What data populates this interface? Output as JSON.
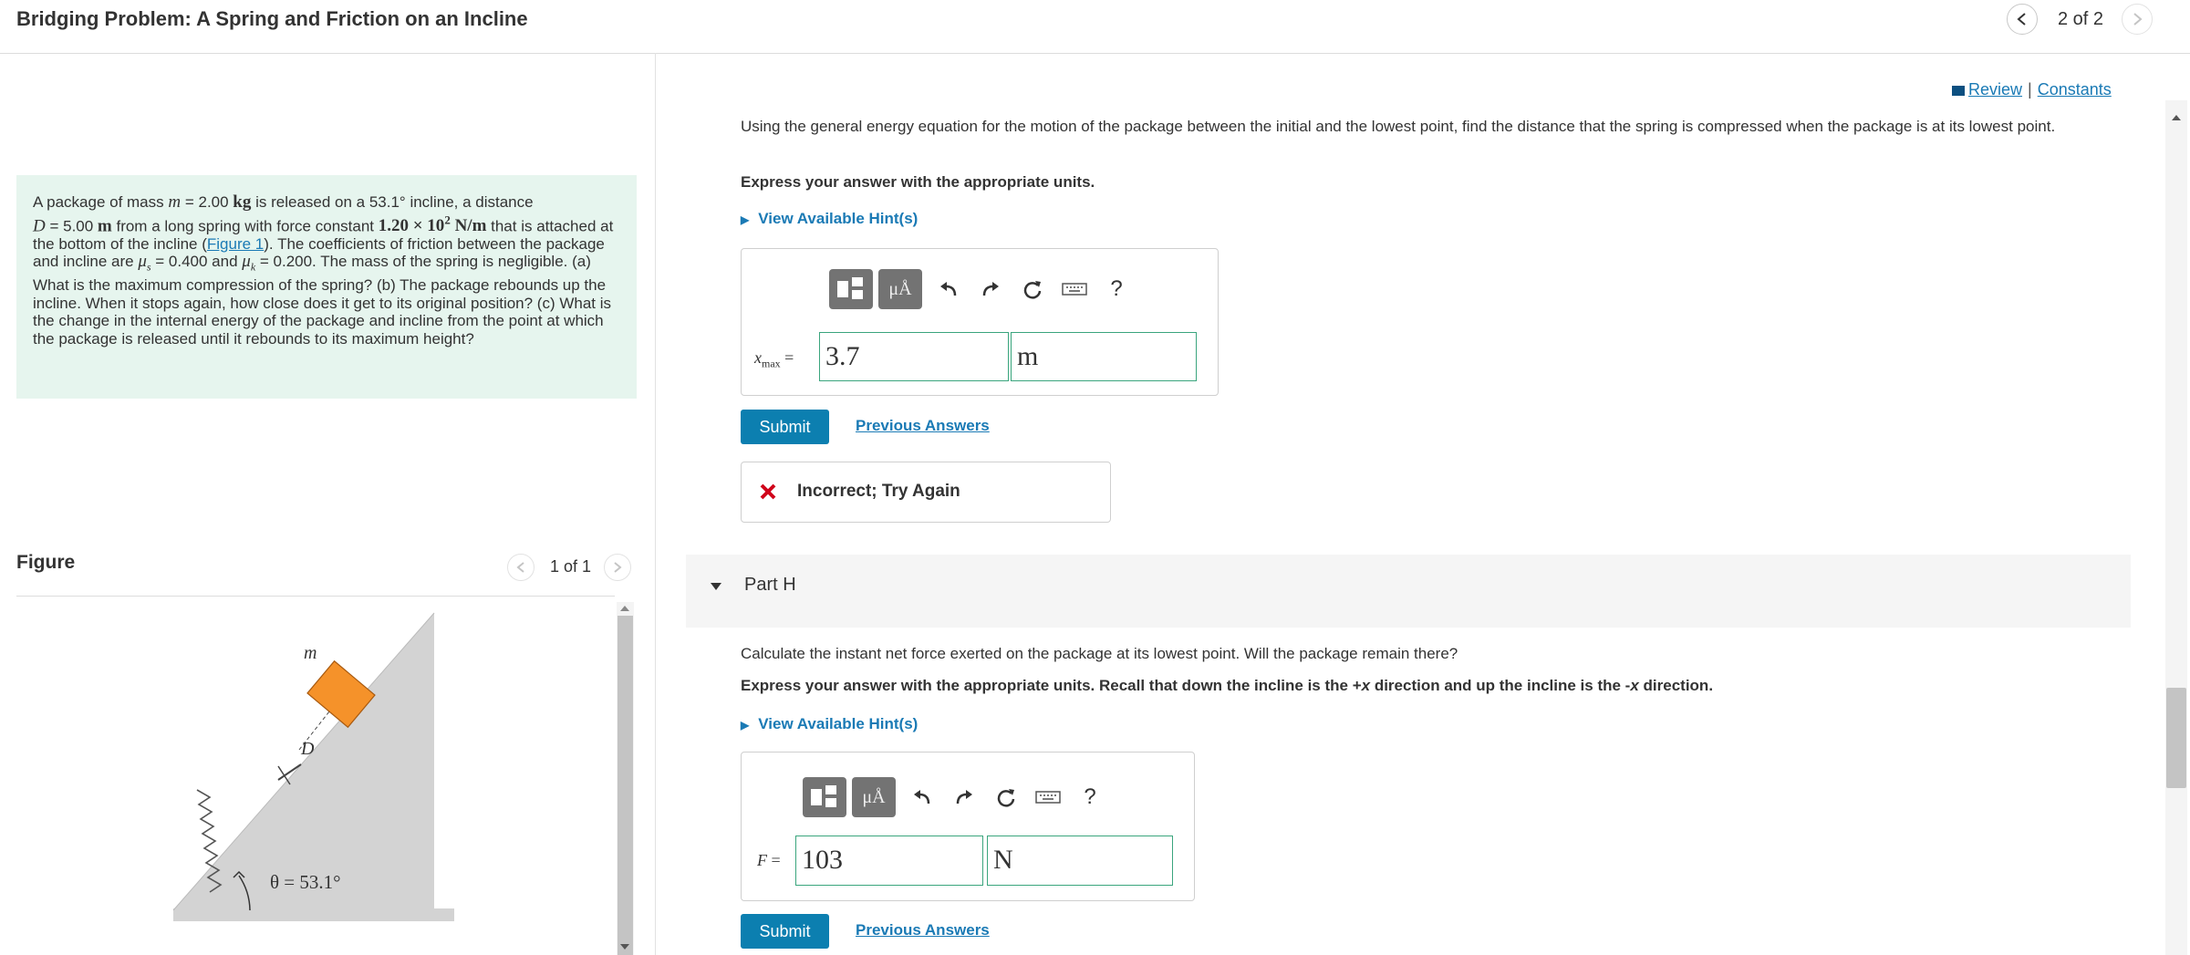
{
  "header": {
    "title": "Bridging Problem: A Spring and Friction on an Incline",
    "page_counter": "2 of 2"
  },
  "problem": {
    "t1": "A package of mass ",
    "m_sym": "m",
    "t2": " = 2.00 ",
    "kg": "kg",
    "t3": " is released on a 53.1° incline, a distance",
    "D_sym": "D",
    "t4": " = 5.00 ",
    "m_unit": "m",
    "t5": " from a long spring with force constant ",
    "k_val": "1.20 × 10",
    "k_exp": "2",
    "k_unit": " N/m",
    "t6": " that is attached at the bottom of the incline (",
    "figure_link": "Figure 1",
    "t7": "). The coefficients of friction between the package and incline are ",
    "mus": "μ",
    "mus_sub": "s",
    "t8": " = 0.400 and ",
    "muk": "μ",
    "muk_sub": "k",
    "t9": " = 0.200. The mass of the spring is negligible. (a) What is the maximum compression of the spring? (b) The package rebounds up the incline. When it stops again, how close does it get to its original position? (c) What is the change in the internal energy of the package and incline from the point at which the package is released until it rebounds to its maximum height?"
  },
  "figure": {
    "label": "Figure",
    "counter": "1 of 1",
    "mass_label": "m",
    "distance_label": "D",
    "angle_label": "θ = 53.1°"
  },
  "links": {
    "review": "Review",
    "separator": "|",
    "constants": "Constants"
  },
  "partG": {
    "question": "Using the general energy equation for the motion of the package between the initial and the lowest point, find the distance that the spring is compressed when the package is at its lowest point.",
    "instruction": "Express your answer with the appropriate units.",
    "hint": "View Available Hint(s)",
    "var_main": "x",
    "var_sub": "max",
    "equals": "=",
    "value": "3.7",
    "unit": "m",
    "submit": "Submit",
    "previous": "Previous Answers",
    "feedback": "Incorrect; Try Again"
  },
  "partH": {
    "label": "Part H",
    "question": "Calculate the instant net force exerted on the package at its lowest point. Will the package remain there?",
    "instruction_a": "Express your answer with the appropriate units. Recall that down the incline is the +",
    "instruction_x1": "x",
    "instruction_b": " direction and up the incline is the -",
    "instruction_x2": "x",
    "instruction_c": " direction.",
    "hint": "View Available Hint(s)",
    "var_main": "F",
    "equals": "=",
    "value": "103",
    "unit": "N",
    "submit": "Submit",
    "previous": "Previous Answers"
  },
  "toolbar": {
    "units_glyph": "μÅ",
    "help": "?"
  },
  "colors": {
    "accent": "#0c7fb0",
    "link": "#1a7ab5",
    "problem_bg": "#e6f5ee",
    "input_border": "#3aa57d",
    "error": "#d0021b",
    "package": "#f5922a"
  }
}
